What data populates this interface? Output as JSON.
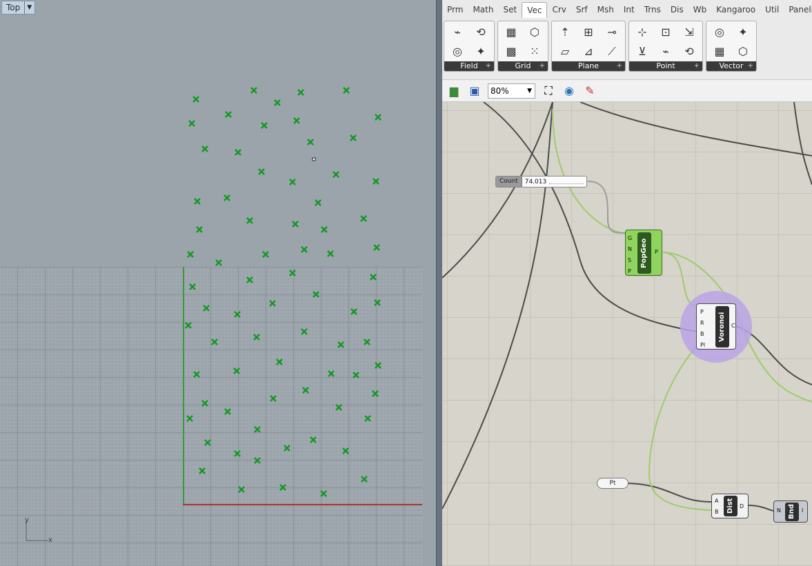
{
  "viewport": {
    "name": "Top",
    "axis_y": "y",
    "axis_x": "x"
  },
  "gh": {
    "tabs": [
      "Prm",
      "Math",
      "Set",
      "Vec",
      "Crv",
      "Srf",
      "Msh",
      "Int",
      "Trns",
      "Dis",
      "Wb",
      "Kangaroo",
      "Util",
      "PanelingT"
    ],
    "active_tab": "Vec",
    "panels": [
      {
        "label": "Field",
        "icons": [
          "field-line-icon",
          "field-spin-icon",
          "field-point-icon",
          "field-vortex-icon"
        ]
      },
      {
        "label": "Grid",
        "icons": [
          "grid-rect-icon",
          "grid-hex-icon",
          "grid-square-icon",
          "grid-populate-icon"
        ]
      },
      {
        "label": "Plane",
        "icons": [
          "plane-align-icon",
          "plane-construct-icon",
          "plane-origin-icon",
          "plane-xy-icon",
          "plane-normal-icon",
          "plane-rotate-icon"
        ]
      },
      {
        "label": "Point",
        "icons": [
          "point-construct-icon",
          "point-distance-icon",
          "point-cloud-icon",
          "point-deconstruct-icon",
          "point-project-icon",
          "point-pull-icon"
        ]
      },
      {
        "label": "Vector",
        "icons": [
          "vector-xyz-icon",
          "vector-2pt-icon",
          "vector-deconstruct-icon",
          "vector-display-icon"
        ]
      }
    ],
    "zoom": "80%",
    "slider": {
      "label": "Count",
      "value": "74.013"
    },
    "components": {
      "popgeo": {
        "name": "PopGeo",
        "inputs": [
          "G",
          "N",
          "S",
          "P"
        ],
        "outputs": [
          "P"
        ]
      },
      "voronoi": {
        "name": "Voronoi",
        "inputs": [
          "P",
          "R",
          "B",
          "Pl"
        ],
        "outputs": [
          "C"
        ]
      },
      "pt": {
        "name": "Pt"
      },
      "dist": {
        "name": "Dist",
        "inputs": [
          "A",
          "B"
        ],
        "outputs": [
          "D"
        ]
      },
      "bnd": {
        "name": "Bnd",
        "inputs": [
          "N"
        ],
        "outputs": [
          "I"
        ]
      }
    }
  }
}
